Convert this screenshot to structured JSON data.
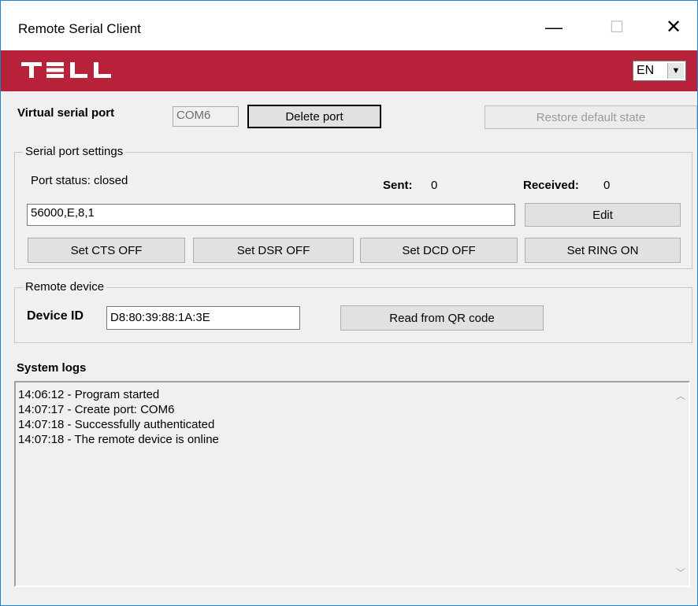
{
  "window": {
    "title": "Remote Serial Client",
    "min_glyph": "—",
    "max_glyph": "☐",
    "close_glyph": "✕"
  },
  "banner": {
    "logo_text": "TELL",
    "language": "EN",
    "language_arrow": "▼",
    "brand_color": "#b8213a"
  },
  "virtual_port": {
    "label": "Virtual serial port",
    "port_value": "COM6",
    "delete_label": "Delete port",
    "restore_label": "Restore default state"
  },
  "serial_settings": {
    "legend": "Serial port settings",
    "status": "Port status: closed",
    "sent_label": "Sent:",
    "sent_value": "0",
    "received_label": "Received:",
    "received_value": "0",
    "config_value": "56000,E,8,1",
    "edit_label": "Edit",
    "buttons": [
      "Set CTS OFF",
      "Set DSR OFF",
      "Set DCD OFF",
      "Set RING ON"
    ]
  },
  "remote_device": {
    "legend": "Remote device",
    "device_id_label": "Device ID",
    "device_id_value": "D8:80:39:88:1A:3E",
    "qr_label": "Read from QR code"
  },
  "logs": {
    "title": "System logs",
    "lines": [
      "14:06:12 - Program started",
      "14:07:17 - Create port: COM6",
      "14:07:18 - Successfully authenticated",
      "14:07:18 - The remote device is online"
    ],
    "scroll_up": "︿",
    "scroll_down": "﹀"
  }
}
